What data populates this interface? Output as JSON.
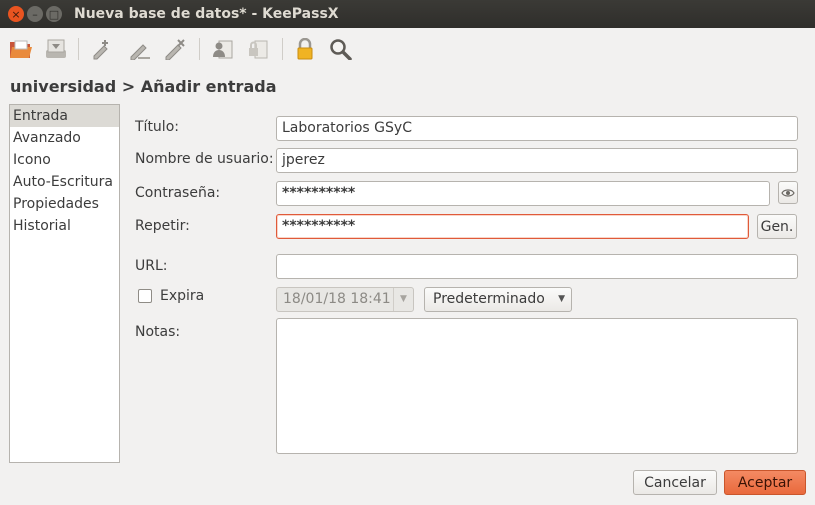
{
  "window": {
    "title": "Nueva base de datos* - KeePassX",
    "buttons": {
      "close": "×",
      "minimize": "–",
      "maximize": "□"
    }
  },
  "toolbar": {
    "icons": [
      "open-database-icon",
      "save-database-icon",
      "add-entry-icon",
      "edit-entry-icon",
      "delete-entry-icon",
      "copy-username-icon",
      "copy-password-icon",
      "lock-database-icon",
      "search-icon"
    ]
  },
  "breadcrumb": "universidad > Añadir entrada",
  "sidebar": {
    "items": [
      {
        "label": "Entrada"
      },
      {
        "label": "Avanzado"
      },
      {
        "label": "Icono"
      },
      {
        "label": "Auto-Escritura"
      },
      {
        "label": "Propiedades"
      },
      {
        "label": "Historial"
      }
    ]
  },
  "form": {
    "title_label": "Título:",
    "title_value": "Laboratorios GSyC",
    "username_label": "Nombre de usuario:",
    "username_value": "jperez",
    "password_label": "Contraseña:",
    "password_value": "**********",
    "repeat_label": "Repetir:",
    "repeat_value": "**********",
    "gen_label": "Gen.",
    "url_label": "URL:",
    "url_value": "",
    "expires_label": "Expira",
    "expires_checked": false,
    "expires_date": "18/01/18 18:41",
    "preset_value": "Predeterminado",
    "notes_label": "Notas:",
    "notes_value": ""
  },
  "buttons": {
    "cancel": "Cancelar",
    "accept": "Aceptar"
  },
  "colors": {
    "accent": "#e95420",
    "titlebar": "#33322f",
    "error_border": "#e05a3a"
  }
}
